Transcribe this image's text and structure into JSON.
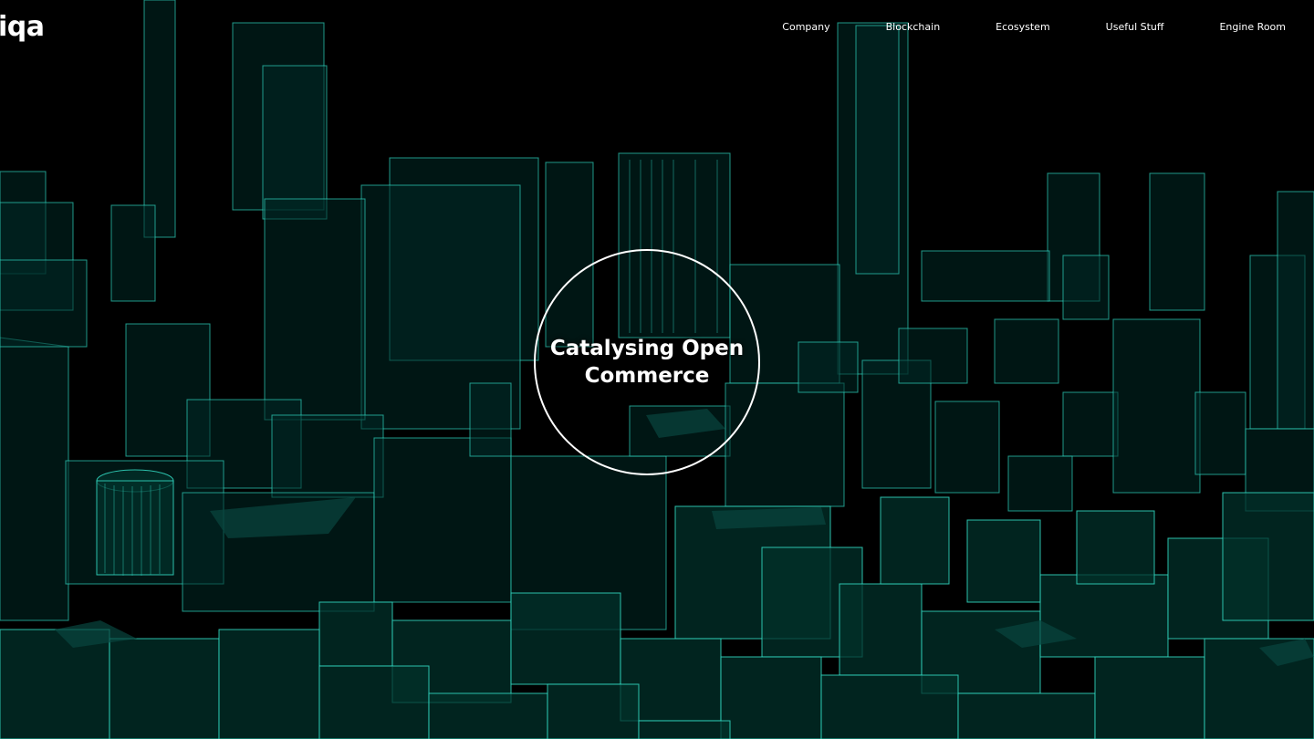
{
  "brand": {
    "logo_text": "iqa"
  },
  "nav": {
    "items": [
      {
        "label": "Company"
      },
      {
        "label": "Blockchain"
      },
      {
        "label": "Ecosystem"
      },
      {
        "label": "Useful Stuff"
      },
      {
        "label": "Engine Room"
      }
    ]
  },
  "hero": {
    "title": "Catalysing Open Commerce"
  },
  "colors": {
    "background": "#000000",
    "wireframe": "#2fd3bd",
    "text": "#ffffff"
  }
}
